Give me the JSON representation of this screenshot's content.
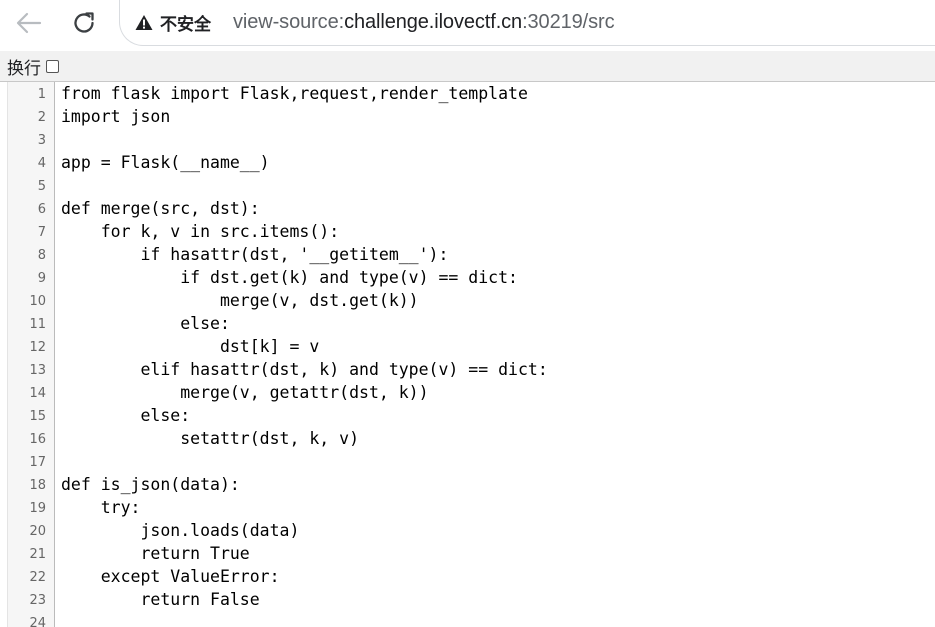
{
  "browser": {
    "security_label": "不安全",
    "url_scheme": "view-source:",
    "url_host": "challenge.ilovectf.cn",
    "url_rest": ":30219/src",
    "icons": {
      "back": "arrow-left-icon",
      "reload": "reload-icon",
      "warning": "warning-triangle-icon"
    }
  },
  "viewer": {
    "wrap_label": "换行",
    "wrap_checked": false
  },
  "code": {
    "lines": [
      {
        "n": "1",
        "text": "from flask import Flask,request,render_template"
      },
      {
        "n": "2",
        "text": "import json"
      },
      {
        "n": "3",
        "text": ""
      },
      {
        "n": "4",
        "text": "app = Flask(__name__)"
      },
      {
        "n": "5",
        "text": ""
      },
      {
        "n": "6",
        "text": "def merge(src, dst):"
      },
      {
        "n": "7",
        "text": "    for k, v in src.items():"
      },
      {
        "n": "8",
        "text": "        if hasattr(dst, '__getitem__'):"
      },
      {
        "n": "9",
        "text": "            if dst.get(k) and type(v) == dict:"
      },
      {
        "n": "10",
        "text": "                merge(v, dst.get(k))"
      },
      {
        "n": "11",
        "text": "            else:"
      },
      {
        "n": "12",
        "text": "                dst[k] = v"
      },
      {
        "n": "13",
        "text": "        elif hasattr(dst, k) and type(v) == dict:"
      },
      {
        "n": "14",
        "text": "            merge(v, getattr(dst, k))"
      },
      {
        "n": "15",
        "text": "        else:"
      },
      {
        "n": "16",
        "text": "            setattr(dst, k, v)"
      },
      {
        "n": "17",
        "text": ""
      },
      {
        "n": "18",
        "text": "def is_json(data):"
      },
      {
        "n": "19",
        "text": "    try:"
      },
      {
        "n": "20",
        "text": "        json.loads(data)"
      },
      {
        "n": "21",
        "text": "        return True"
      },
      {
        "n": "22",
        "text": "    except ValueError:"
      },
      {
        "n": "23",
        "text": "        return False"
      },
      {
        "n": "24",
        "text": ""
      }
    ]
  }
}
